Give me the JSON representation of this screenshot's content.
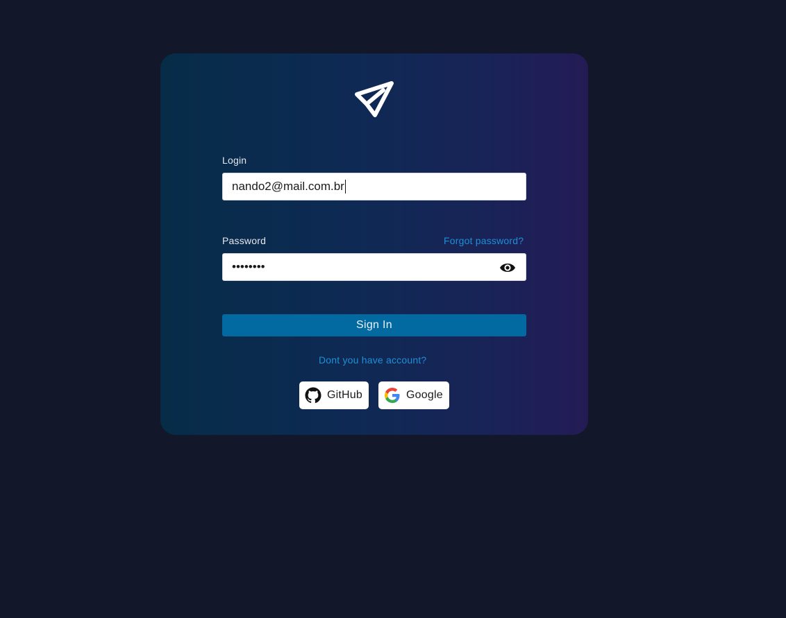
{
  "login": {
    "label": "Login",
    "value": "nando2@mail.com.br"
  },
  "password": {
    "label": "Password",
    "masked_value": "••••••••",
    "forgot_link": "Forgot password?",
    "toggle_icon": "eye-icon"
  },
  "actions": {
    "sign_in_label": "Sign In",
    "signup_link": "Dont you have account?"
  },
  "social": [
    {
      "label": "GitHub",
      "icon": "github-icon"
    },
    {
      "label": "Google",
      "icon": "google-icon"
    }
  ],
  "colors": {
    "page_bg": "#121829",
    "primary": "#0369a1",
    "link": "#1f8fd6"
  }
}
